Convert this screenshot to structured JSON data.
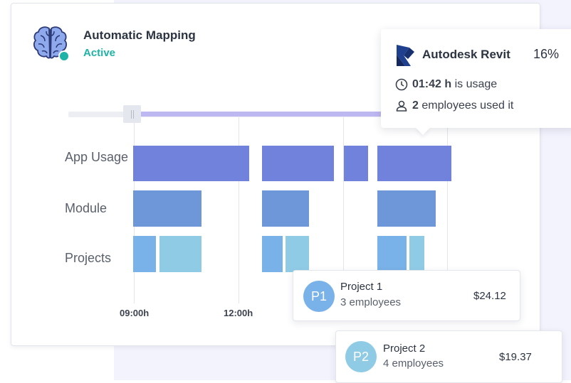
{
  "header": {
    "title": "Automatic Mapping",
    "status": "Active"
  },
  "colors": {
    "accent": "#1fb3a7",
    "app_usage_bar": "#7082dc",
    "module_bar": "#6e97d9",
    "projects_bar_dark": "#79b2e8",
    "projects_bar_light": "#90cbe6",
    "timeline_fill": "#bdb7f2"
  },
  "timeline": {
    "rows": [
      {
        "label": "App Usage"
      },
      {
        "label": "Module"
      },
      {
        "label": "Projects"
      }
    ],
    "ticks": [
      "09:00h",
      "12:00h"
    ]
  },
  "tooltip": {
    "app": "Autodesk Revit",
    "percent": "16%",
    "duration": "01:42 h",
    "duration_suffix": "is usage",
    "employees_count": "2",
    "employees_suffix": "employees used it",
    "icons": [
      "revit-logo-icon",
      "clock-icon",
      "person-icon"
    ]
  },
  "projects": [
    {
      "badge": "P1",
      "name": "Project 1",
      "employees": "3 employees",
      "amount": "$24.12"
    },
    {
      "badge": "P2",
      "name": "Project 2",
      "employees": "4 employees",
      "amount": "$19.37"
    }
  ]
}
